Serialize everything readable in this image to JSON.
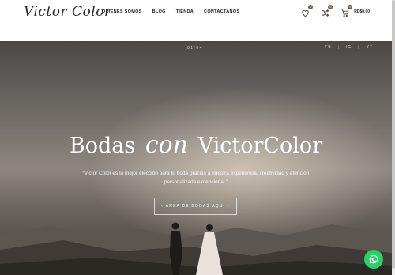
{
  "brand": {
    "logo": "Victor Color"
  },
  "nav": [
    {
      "label": "QUIENES SOMOS"
    },
    {
      "label": "BLOG"
    },
    {
      "label": "TIENDA"
    },
    {
      "label": "CONTACTANOS"
    }
  ],
  "header_actions": {
    "wishlist_count": "0",
    "compare_count": "0",
    "cart_count": "0",
    "cart_total": "RD$0.00"
  },
  "hero": {
    "counter": "01/04",
    "social": [
      "FB",
      "IG",
      "YT"
    ],
    "title_left": "Bodas",
    "title_script": "con",
    "title_right": "VictorColor",
    "subtitle": "“Victor Color es la mejor elección para tu boda gracias a nuestra experiencia, creatividad y atención personalizada excepcional.”",
    "cta_label": "‹ ÁREA DE BODAS AQUÍ ›"
  },
  "colors": {
    "accent": "#7a5a3a",
    "whatsapp": "#25d366"
  }
}
